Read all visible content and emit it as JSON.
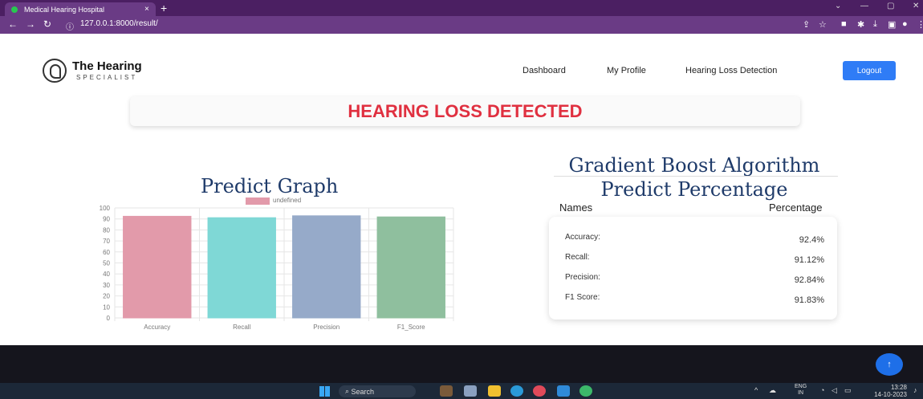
{
  "browser": {
    "tab_title": "Medical Hearing Hospital",
    "tab_close": "×",
    "new_tab": "+",
    "url": "127.0.0.1:8000/result/",
    "info_icon": "ⓘ"
  },
  "site": {
    "logo_title": "The Hearing",
    "logo_subtitle": "SPECIALIST",
    "nav": {
      "dashboard": "Dashboard",
      "profile": "My Profile",
      "detection": "Hearing Loss Detection"
    },
    "logout": "Logout",
    "banner": "HEARING LOSS DETECTED"
  },
  "predict_graph": {
    "title": "Predict Graph",
    "legend": "undefined"
  },
  "chart_data": {
    "type": "bar",
    "categories": [
      "Accuracy",
      "Recall",
      "Precision",
      "F1_Score"
    ],
    "series": [
      {
        "values": [
          92.4,
          91.12,
          92.84,
          91.83
        ]
      }
    ],
    "colors": [
      "#e29aaa",
      "#7fd8d6",
      "#96aac9",
      "#8fbf9e"
    ],
    "ylim": [
      0,
      100
    ],
    "yticks": [
      0,
      10,
      20,
      30,
      40,
      50,
      60,
      70,
      80,
      90,
      100
    ],
    "grid": true,
    "legend_position": "top"
  },
  "algorithm": {
    "title_line1": "Gradient Boost Algorithm",
    "title_line2": "Predict Percentage",
    "col_names": "Names",
    "col_percentage": "Percentage",
    "rows": [
      {
        "name": "Accuracy:",
        "value": "92.4%"
      },
      {
        "name": "Recall:",
        "value": "91.12%"
      },
      {
        "name": "Precision:",
        "value": "92.84%"
      },
      {
        "name": "F1 Score:",
        "value": "91.83%"
      }
    ]
  },
  "taskbar": {
    "search": "Search",
    "lang_line1": "ENG",
    "lang_line2": "IN",
    "time": "13:28",
    "date": "14-10-2023"
  }
}
